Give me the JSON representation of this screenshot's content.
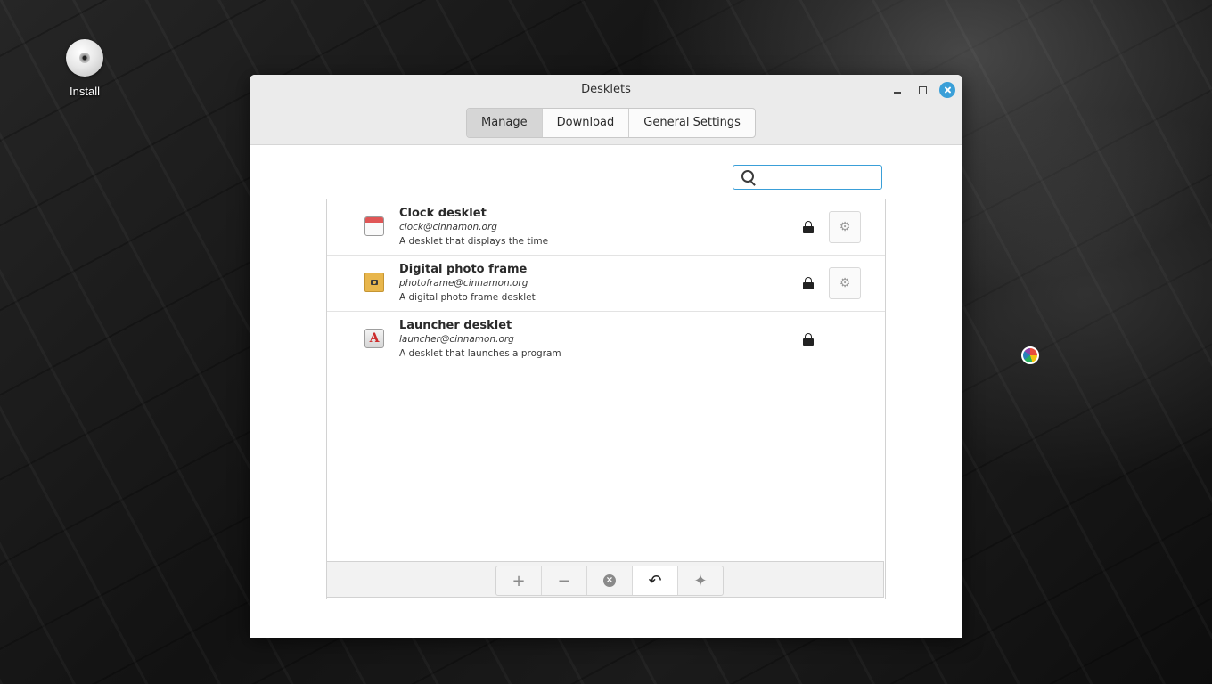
{
  "desktop": {
    "install_label": "Install"
  },
  "window": {
    "title": "Desklets",
    "accent": "#3a9fd8"
  },
  "tabs": [
    {
      "label": "Manage",
      "active": true
    },
    {
      "label": "Download",
      "active": false
    },
    {
      "label": "General Settings",
      "active": false
    }
  ],
  "search": {
    "value": "",
    "placeholder": ""
  },
  "desklets": [
    {
      "name": "Clock desklet",
      "uuid": "clock@cinnamon.org",
      "description": "A desklet that displays the time",
      "icon": "calendar-icon",
      "locked": true,
      "has_config": true
    },
    {
      "name": "Digital photo frame",
      "uuid": "photoframe@cinnamon.org",
      "description": "A digital photo frame desklet",
      "icon": "photo-folder-icon",
      "locked": true,
      "has_config": true
    },
    {
      "name": "Launcher desklet",
      "uuid": "launcher@cinnamon.org",
      "description": "A desklet that launches a program",
      "icon": "launcher-icon",
      "locked": true,
      "has_config": false
    }
  ],
  "toolbar": {
    "add_icon": "+",
    "remove_icon": "−",
    "remove_all_icon": "×",
    "restore_icon": "↶",
    "extra_icon": "✦"
  }
}
